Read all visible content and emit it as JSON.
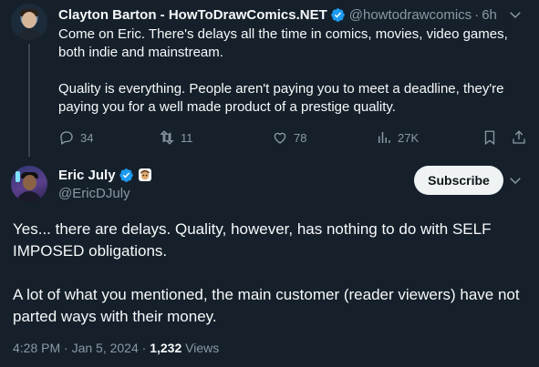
{
  "reply": {
    "author_name": "Clayton Barton - HowToDrawComics.NET",
    "handle": "@howtodrawcomics",
    "separator": "·",
    "time": "6h",
    "paragraphs": [
      "Come on Eric. There's delays all the time in comics, movies, video games, both indie and mainstream.",
      "Quality is everything. People aren't paying you to meet a deadline, they're paying you for a well made product of a prestige quality."
    ],
    "actions": {
      "replies": "34",
      "reposts": "11",
      "likes": "78",
      "views": "27K"
    }
  },
  "main": {
    "author_name": "Eric July",
    "handle": "@EricDJuly",
    "subscribe_label": "Subscribe",
    "paragraphs": [
      "Yes... there are delays. Quality, however, has nothing to do with SELF IMPOSED obligations.",
      "A lot of what you mentioned, the main customer (reader viewers) have not parted ways with their money."
    ],
    "meta": {
      "timestamp": "4:28 PM · Jan 5, 2024 · ",
      "views_count": "1,232",
      "views_label": " Views"
    }
  },
  "colors": {
    "background": "#15202b",
    "text": "#f7f9f9",
    "muted": "#8b98a5",
    "verified_blue": "#1d9bf0",
    "subscribe_bg": "#eff3f4"
  }
}
